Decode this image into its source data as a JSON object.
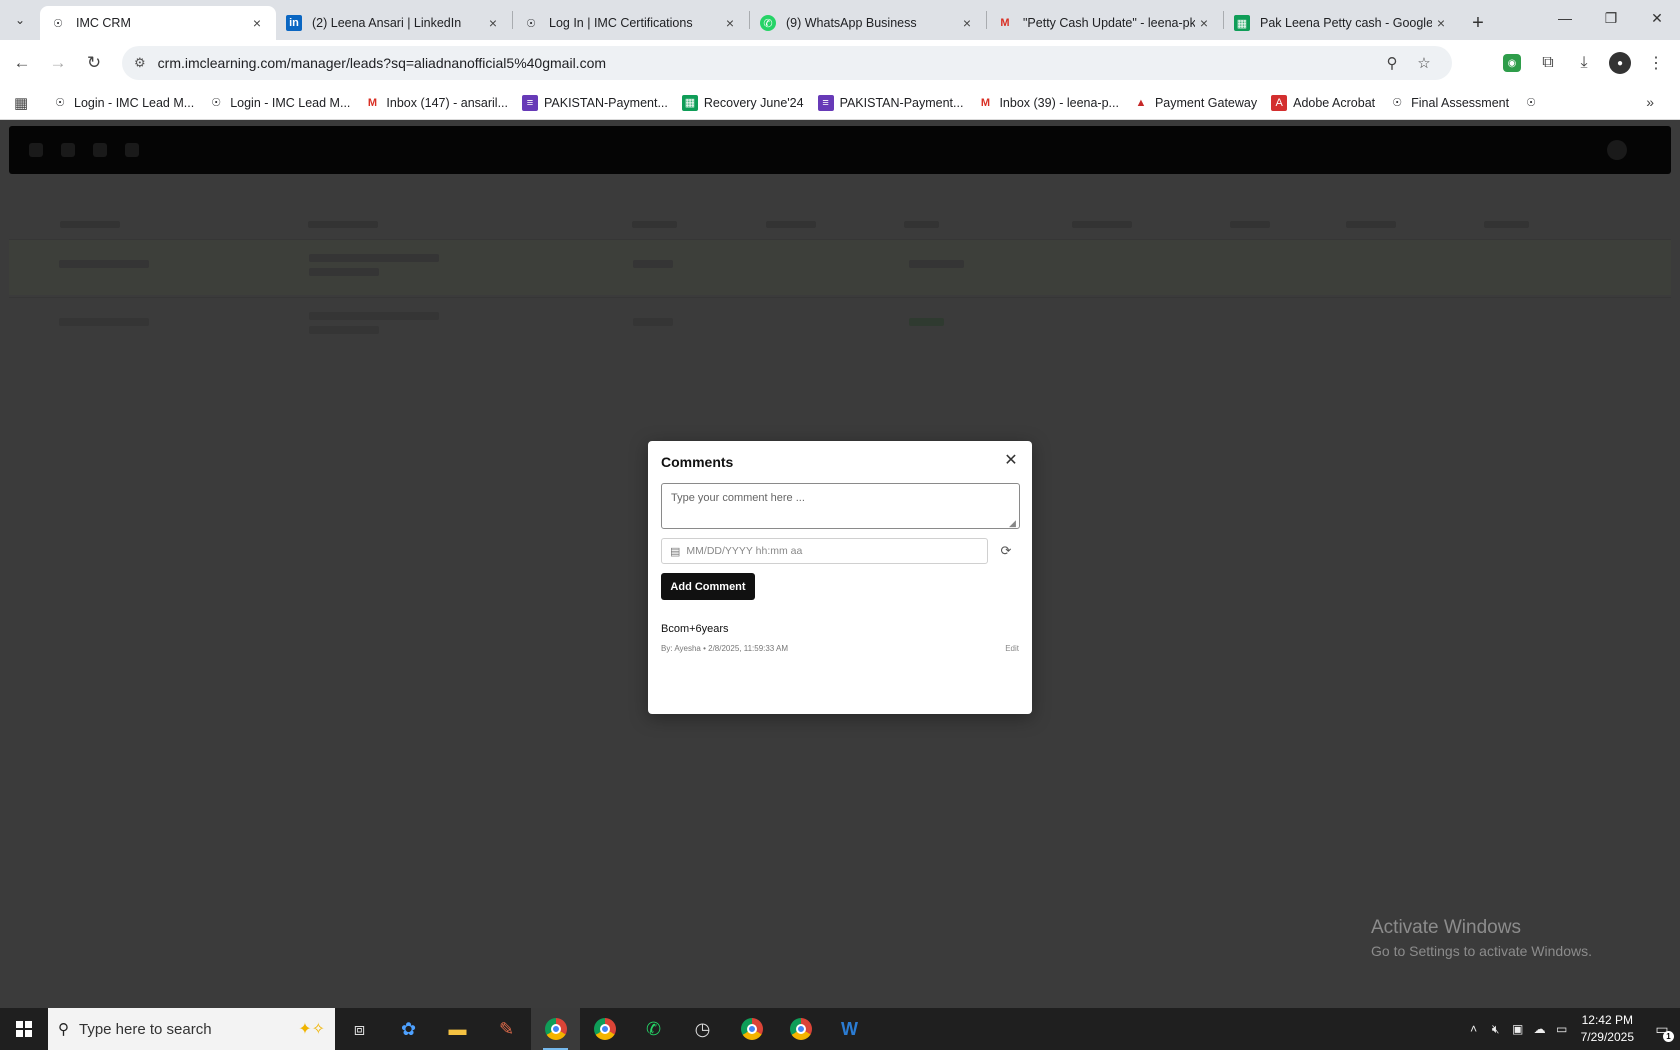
{
  "browser": {
    "tabs": [
      {
        "title": "IMC CRM",
        "icon": "imc-logo-icon",
        "active": true
      },
      {
        "title": "(2) Leena Ansari | LinkedIn",
        "icon": "linkedin-icon",
        "active": false
      },
      {
        "title": "Log In | IMC Certifications",
        "icon": "imc-logo-icon",
        "active": false
      },
      {
        "title": "(9) WhatsApp Business",
        "icon": "whatsapp-icon",
        "active": false
      },
      {
        "title": "\"Petty Cash Update\" - leena-pk",
        "icon": "gmail-icon",
        "active": false
      },
      {
        "title": "Pak Leena Petty cash - Google",
        "icon": "google-sheets-icon",
        "active": false
      }
    ],
    "url": "crm.imclearning.com/manager/leads?sq=aliadnanofficial5%40gmail.com",
    "bookmarks": [
      {
        "label": "Login - IMC Lead M...",
        "icon": "imc-logo-icon"
      },
      {
        "label": "Login - IMC Lead M...",
        "icon": "imc-logo-icon"
      },
      {
        "label": "Inbox (147) - ansaril...",
        "icon": "gmail-icon"
      },
      {
        "label": "PAKISTAN-Payment...",
        "icon": "google-forms-icon"
      },
      {
        "label": "Recovery June'24",
        "icon": "google-sheets-icon"
      },
      {
        "label": "PAKISTAN-Payment...",
        "icon": "google-forms-icon"
      },
      {
        "label": "Inbox (39) - leena-p...",
        "icon": "gmail-icon"
      },
      {
        "label": "Payment Gateway",
        "icon": "payment-gateway-icon"
      },
      {
        "label": "Adobe Acrobat",
        "icon": "adobe-acrobat-icon"
      },
      {
        "label": "Final Assessment",
        "icon": "imc-logo-icon"
      }
    ]
  },
  "modal": {
    "title": "Comments",
    "comment_placeholder": "Type your comment here ...",
    "date_placeholder": "MM/DD/YYYY hh:mm aa",
    "add_button": "Add Comment",
    "comments": [
      {
        "text": "Bcom+6years",
        "meta": "By: Ayesha • 2/8/2025, 11:59:33 AM",
        "edit_label": "Edit"
      }
    ]
  },
  "watermark": {
    "line1": "Activate Windows",
    "line2": "Go to Settings to activate Windows."
  },
  "taskbar": {
    "search_placeholder": "Type here to search",
    "time": "12:42 PM",
    "date": "7/29/2025",
    "notification_count": "1"
  },
  "colors": {
    "modal_button": "#111111",
    "overlay": "#3b3b3b",
    "tab_strip": "#dee1e6",
    "taskbar": "#1f1f1f"
  }
}
